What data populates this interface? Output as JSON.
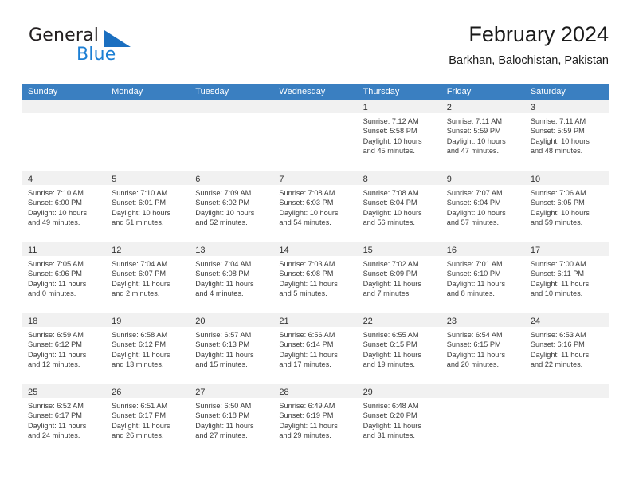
{
  "brand": {
    "name_part1": "General",
    "name_part2": "Blue",
    "triangle_color": "#1b6fc0",
    "blue_color": "#1c7fd4"
  },
  "header": {
    "title": "February 2024",
    "subtitle": "Barkhan, Balochistan, Pakistan"
  },
  "theme": {
    "header_bar": "#3a7fc1",
    "day_head_bg": "#f1f1f1",
    "text": "#3b3b3b"
  },
  "weekday_headers": [
    "Sunday",
    "Monday",
    "Tuesday",
    "Wednesday",
    "Thursday",
    "Friday",
    "Saturday"
  ],
  "weeks": [
    [
      {
        "day": "",
        "sunrise": "",
        "sunset": "",
        "daylight1": "",
        "daylight2": ""
      },
      {
        "day": "",
        "sunrise": "",
        "sunset": "",
        "daylight1": "",
        "daylight2": ""
      },
      {
        "day": "",
        "sunrise": "",
        "sunset": "",
        "daylight1": "",
        "daylight2": ""
      },
      {
        "day": "",
        "sunrise": "",
        "sunset": "",
        "daylight1": "",
        "daylight2": ""
      },
      {
        "day": "1",
        "sunrise": "Sunrise: 7:12 AM",
        "sunset": "Sunset: 5:58 PM",
        "daylight1": "Daylight: 10 hours",
        "daylight2": "and 45 minutes."
      },
      {
        "day": "2",
        "sunrise": "Sunrise: 7:11 AM",
        "sunset": "Sunset: 5:59 PM",
        "daylight1": "Daylight: 10 hours",
        "daylight2": "and 47 minutes."
      },
      {
        "day": "3",
        "sunrise": "Sunrise: 7:11 AM",
        "sunset": "Sunset: 5:59 PM",
        "daylight1": "Daylight: 10 hours",
        "daylight2": "and 48 minutes."
      }
    ],
    [
      {
        "day": "4",
        "sunrise": "Sunrise: 7:10 AM",
        "sunset": "Sunset: 6:00 PM",
        "daylight1": "Daylight: 10 hours",
        "daylight2": "and 49 minutes."
      },
      {
        "day": "5",
        "sunrise": "Sunrise: 7:10 AM",
        "sunset": "Sunset: 6:01 PM",
        "daylight1": "Daylight: 10 hours",
        "daylight2": "and 51 minutes."
      },
      {
        "day": "6",
        "sunrise": "Sunrise: 7:09 AM",
        "sunset": "Sunset: 6:02 PM",
        "daylight1": "Daylight: 10 hours",
        "daylight2": "and 52 minutes."
      },
      {
        "day": "7",
        "sunrise": "Sunrise: 7:08 AM",
        "sunset": "Sunset: 6:03 PM",
        "daylight1": "Daylight: 10 hours",
        "daylight2": "and 54 minutes."
      },
      {
        "day": "8",
        "sunrise": "Sunrise: 7:08 AM",
        "sunset": "Sunset: 6:04 PM",
        "daylight1": "Daylight: 10 hours",
        "daylight2": "and 56 minutes."
      },
      {
        "day": "9",
        "sunrise": "Sunrise: 7:07 AM",
        "sunset": "Sunset: 6:04 PM",
        "daylight1": "Daylight: 10 hours",
        "daylight2": "and 57 minutes."
      },
      {
        "day": "10",
        "sunrise": "Sunrise: 7:06 AM",
        "sunset": "Sunset: 6:05 PM",
        "daylight1": "Daylight: 10 hours",
        "daylight2": "and 59 minutes."
      }
    ],
    [
      {
        "day": "11",
        "sunrise": "Sunrise: 7:05 AM",
        "sunset": "Sunset: 6:06 PM",
        "daylight1": "Daylight: 11 hours",
        "daylight2": "and 0 minutes."
      },
      {
        "day": "12",
        "sunrise": "Sunrise: 7:04 AM",
        "sunset": "Sunset: 6:07 PM",
        "daylight1": "Daylight: 11 hours",
        "daylight2": "and 2 minutes."
      },
      {
        "day": "13",
        "sunrise": "Sunrise: 7:04 AM",
        "sunset": "Sunset: 6:08 PM",
        "daylight1": "Daylight: 11 hours",
        "daylight2": "and 4 minutes."
      },
      {
        "day": "14",
        "sunrise": "Sunrise: 7:03 AM",
        "sunset": "Sunset: 6:08 PM",
        "daylight1": "Daylight: 11 hours",
        "daylight2": "and 5 minutes."
      },
      {
        "day": "15",
        "sunrise": "Sunrise: 7:02 AM",
        "sunset": "Sunset: 6:09 PM",
        "daylight1": "Daylight: 11 hours",
        "daylight2": "and 7 minutes."
      },
      {
        "day": "16",
        "sunrise": "Sunrise: 7:01 AM",
        "sunset": "Sunset: 6:10 PM",
        "daylight1": "Daylight: 11 hours",
        "daylight2": "and 8 minutes."
      },
      {
        "day": "17",
        "sunrise": "Sunrise: 7:00 AM",
        "sunset": "Sunset: 6:11 PM",
        "daylight1": "Daylight: 11 hours",
        "daylight2": "and 10 minutes."
      }
    ],
    [
      {
        "day": "18",
        "sunrise": "Sunrise: 6:59 AM",
        "sunset": "Sunset: 6:12 PM",
        "daylight1": "Daylight: 11 hours",
        "daylight2": "and 12 minutes."
      },
      {
        "day": "19",
        "sunrise": "Sunrise: 6:58 AM",
        "sunset": "Sunset: 6:12 PM",
        "daylight1": "Daylight: 11 hours",
        "daylight2": "and 13 minutes."
      },
      {
        "day": "20",
        "sunrise": "Sunrise: 6:57 AM",
        "sunset": "Sunset: 6:13 PM",
        "daylight1": "Daylight: 11 hours",
        "daylight2": "and 15 minutes."
      },
      {
        "day": "21",
        "sunrise": "Sunrise: 6:56 AM",
        "sunset": "Sunset: 6:14 PM",
        "daylight1": "Daylight: 11 hours",
        "daylight2": "and 17 minutes."
      },
      {
        "day": "22",
        "sunrise": "Sunrise: 6:55 AM",
        "sunset": "Sunset: 6:15 PM",
        "daylight1": "Daylight: 11 hours",
        "daylight2": "and 19 minutes."
      },
      {
        "day": "23",
        "sunrise": "Sunrise: 6:54 AM",
        "sunset": "Sunset: 6:15 PM",
        "daylight1": "Daylight: 11 hours",
        "daylight2": "and 20 minutes."
      },
      {
        "day": "24",
        "sunrise": "Sunrise: 6:53 AM",
        "sunset": "Sunset: 6:16 PM",
        "daylight1": "Daylight: 11 hours",
        "daylight2": "and 22 minutes."
      }
    ],
    [
      {
        "day": "25",
        "sunrise": "Sunrise: 6:52 AM",
        "sunset": "Sunset: 6:17 PM",
        "daylight1": "Daylight: 11 hours",
        "daylight2": "and 24 minutes."
      },
      {
        "day": "26",
        "sunrise": "Sunrise: 6:51 AM",
        "sunset": "Sunset: 6:17 PM",
        "daylight1": "Daylight: 11 hours",
        "daylight2": "and 26 minutes."
      },
      {
        "day": "27",
        "sunrise": "Sunrise: 6:50 AM",
        "sunset": "Sunset: 6:18 PM",
        "daylight1": "Daylight: 11 hours",
        "daylight2": "and 27 minutes."
      },
      {
        "day": "28",
        "sunrise": "Sunrise: 6:49 AM",
        "sunset": "Sunset: 6:19 PM",
        "daylight1": "Daylight: 11 hours",
        "daylight2": "and 29 minutes."
      },
      {
        "day": "29",
        "sunrise": "Sunrise: 6:48 AM",
        "sunset": "Sunset: 6:20 PM",
        "daylight1": "Daylight: 11 hours",
        "daylight2": "and 31 minutes."
      },
      {
        "day": "",
        "sunrise": "",
        "sunset": "",
        "daylight1": "",
        "daylight2": ""
      },
      {
        "day": "",
        "sunrise": "",
        "sunset": "",
        "daylight1": "",
        "daylight2": ""
      }
    ]
  ]
}
